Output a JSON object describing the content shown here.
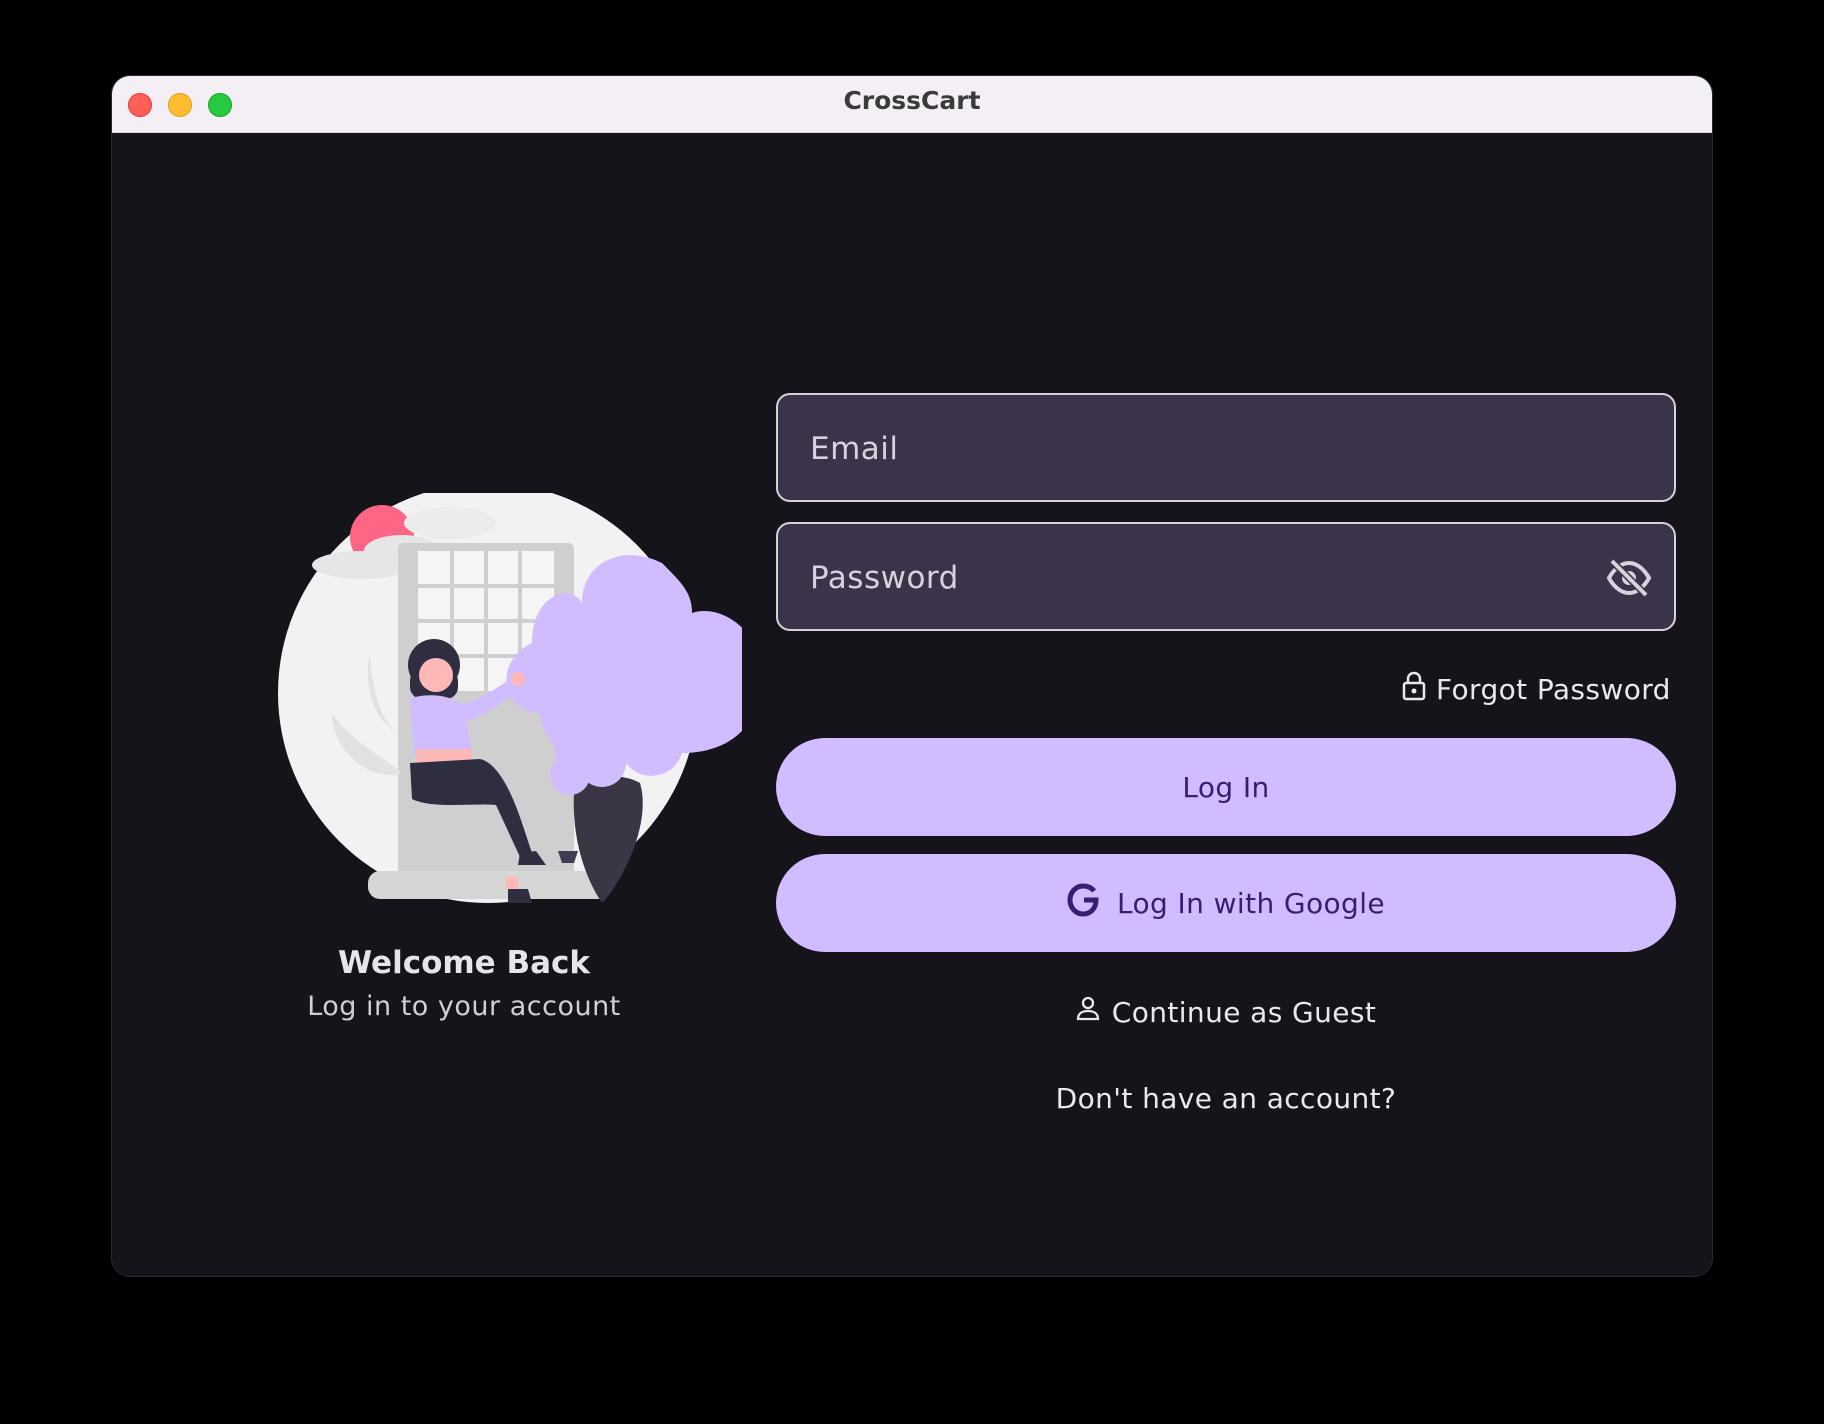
{
  "window": {
    "title": "CrossCart"
  },
  "welcome": {
    "title": "Welcome Back",
    "subtitle": "Log in to your account"
  },
  "form": {
    "email_placeholder": "Email",
    "email_value": "",
    "password_placeholder": "Password",
    "password_value": "",
    "forgot_password_label": "Forgot Password",
    "login_label": "Log In",
    "google_login_label": "Log In with Google",
    "guest_label": "Continue as Guest",
    "signup_prompt": "Don't have an account?"
  },
  "icons": {
    "password_toggle": "eye-off-icon",
    "forgot_password": "lock-icon",
    "google": "google-icon",
    "guest": "person-icon"
  },
  "colors": {
    "background": "#15141b",
    "field_background": "#3b3349",
    "field_border": "#d6d0d9",
    "button_background": "#d0bcff",
    "button_text": "#381e72",
    "text_primary": "#ece6f0",
    "illustration_accent": "#ff6584",
    "illustration_plant": "#d0bcff"
  }
}
